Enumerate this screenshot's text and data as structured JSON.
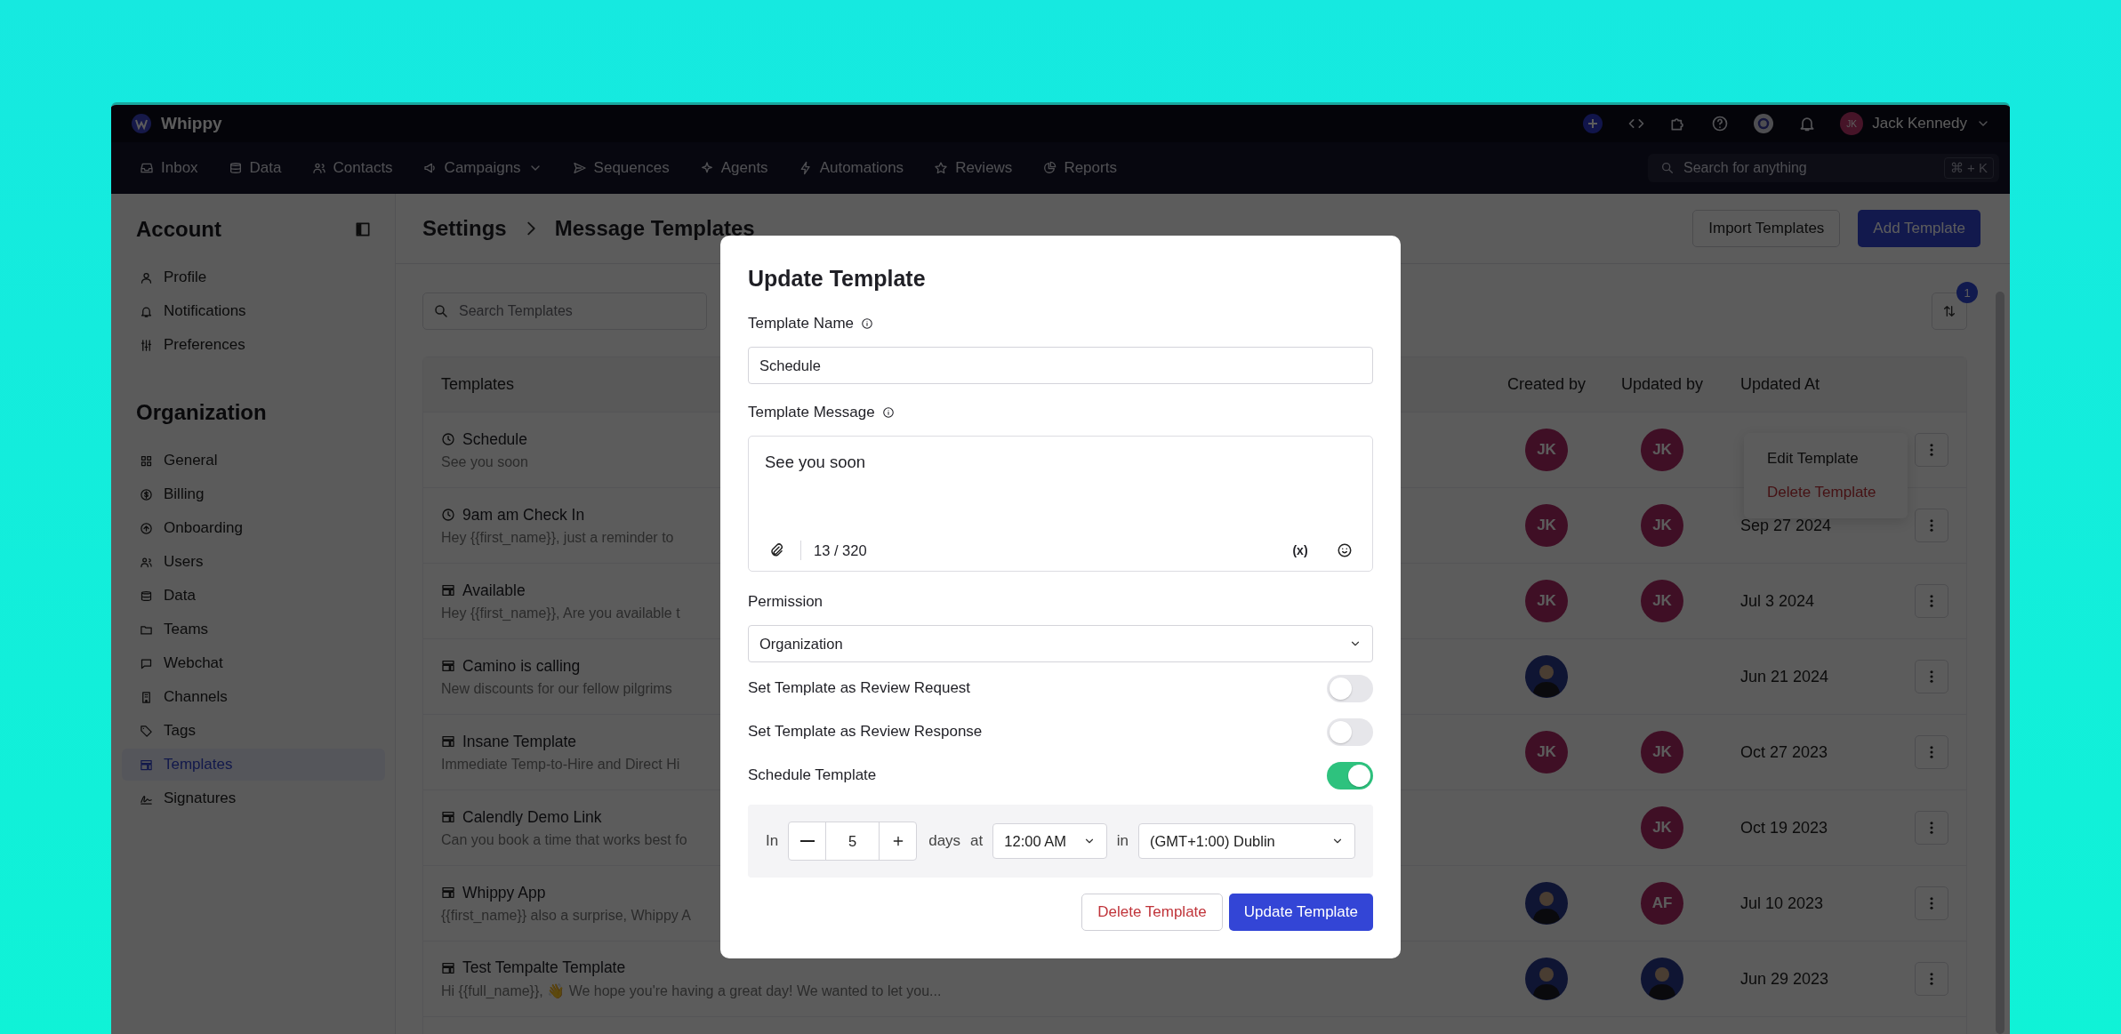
{
  "app": {
    "name": "Whippy"
  },
  "top_bar": {
    "user": {
      "initials": "JK",
      "name": "Jack Kennedy"
    }
  },
  "nav": {
    "items": [
      {
        "label": "Inbox",
        "dropdown": false
      },
      {
        "label": "Data",
        "dropdown": false
      },
      {
        "label": "Contacts",
        "dropdown": false
      },
      {
        "label": "Campaigns",
        "dropdown": true
      },
      {
        "label": "Sequences",
        "dropdown": false
      },
      {
        "label": "Agents",
        "dropdown": false
      },
      {
        "label": "Automations",
        "dropdown": false
      },
      {
        "label": "Reviews",
        "dropdown": false
      },
      {
        "label": "Reports",
        "dropdown": false
      }
    ],
    "search": {
      "placeholder": "Search for anything",
      "shortcut": "⌘ + K"
    }
  },
  "sidebar": {
    "sections": [
      {
        "title": "Account",
        "items": [
          {
            "label": "Profile",
            "selected": false
          },
          {
            "label": "Notifications",
            "selected": false
          },
          {
            "label": "Preferences",
            "selected": false
          }
        ]
      },
      {
        "title": "Organization",
        "items": [
          {
            "label": "General",
            "selected": false
          },
          {
            "label": "Billing",
            "selected": false
          },
          {
            "label": "Onboarding",
            "selected": false
          },
          {
            "label": "Users",
            "selected": false
          },
          {
            "label": "Data",
            "selected": false
          },
          {
            "label": "Teams",
            "selected": false
          },
          {
            "label": "Webchat",
            "selected": false
          },
          {
            "label": "Channels",
            "selected": false
          },
          {
            "label": "Tags",
            "selected": false
          },
          {
            "label": "Templates",
            "selected": true
          },
          {
            "label": "Signatures",
            "selected": false
          }
        ]
      }
    ]
  },
  "breadcrumb": [
    "Settings",
    "Message Templates"
  ],
  "header_buttons": [
    {
      "label": "Import Templates",
      "kind": "secondary"
    },
    {
      "label": "Add Template",
      "kind": "primary"
    }
  ],
  "search": {
    "placeholder": "Search Templates"
  },
  "sort": {
    "badge": "1"
  },
  "table": {
    "columns": [
      "Templates",
      "Created by",
      "Updated by",
      "Updated At"
    ],
    "rows": [
      {
        "kind": "scheduled",
        "name": "Schedule",
        "message": "See you soon",
        "created_by": {
          "kind": "initials",
          "initials": "JK"
        },
        "updated_by": {
          "kind": "initials",
          "initials": "JK"
        }
      },
      {
        "kind": "scheduled",
        "name": "9am am Check In",
        "message": "Hey {{first_name}}, just a reminder to",
        "created_by": {
          "kind": "initials",
          "initials": "JK"
        },
        "updated_by": {
          "kind": "initials",
          "initials": "JK"
        },
        "updated_at": "Sep 27 2024"
      },
      {
        "kind": "standard",
        "name": "Available",
        "message": "Hey {{first_name}}, Are you available t",
        "created_by": {
          "kind": "initials",
          "initials": "JK"
        },
        "updated_by": {
          "kind": "initials",
          "initials": "JK"
        },
        "updated_at": "Jul 3 2024"
      },
      {
        "kind": "standard",
        "name": "Camino is calling",
        "message": "New discounts for our fellow pilgrims",
        "created_by": {
          "kind": "photo"
        },
        "updated_at": "Jun 21 2024"
      },
      {
        "kind": "standard",
        "name": "Insane Template",
        "message": "Immediate Temp-to-Hire and Direct Hi",
        "created_by": {
          "kind": "initials",
          "initials": "JK"
        },
        "updated_by": {
          "kind": "initials",
          "initials": "JK"
        },
        "updated_at": "Oct 27 2023"
      },
      {
        "kind": "standard",
        "name": "Calendly Demo Link",
        "message": "Can you book a time that works best fo",
        "updated_by": {
          "kind": "initials",
          "initials": "JK"
        },
        "updated_at": "Oct 19 2023"
      },
      {
        "kind": "standard",
        "name": "Whippy App",
        "message": "{{first_name}} also a surprise, Whippy A",
        "created_by": {
          "kind": "photo"
        },
        "updated_by": {
          "kind": "initials",
          "initials": "AF"
        },
        "updated_at": "Jul 10 2023"
      },
      {
        "kind": "standard",
        "name": "Test Tempalte Template",
        "message": "Hi {{full_name}}, 👋 We hope you're having a great day! We wanted to let you...",
        "created_by": {
          "kind": "photo"
        },
        "updated_by": {
          "kind": "photo"
        },
        "updated_at": "Jun 29 2023"
      }
    ]
  },
  "context_menu": {
    "items": [
      {
        "label": "Edit Template",
        "kind": "normal"
      },
      {
        "label": "Delete Template",
        "kind": "danger"
      }
    ]
  },
  "modal": {
    "title": "Update Template",
    "name_field": {
      "label": "Template Name",
      "value": "Schedule"
    },
    "message_field": {
      "label": "Template Message",
      "value": "See you soon",
      "counter": "13 / 320",
      "variable_button": "(x)"
    },
    "permission": {
      "label": "Permission",
      "value": "Organization"
    },
    "toggles": [
      {
        "label": "Set Template as Review Request",
        "on": false
      },
      {
        "label": "Set Template as Review Response",
        "on": false
      },
      {
        "label": "Schedule Template",
        "on": true
      }
    ],
    "schedule": {
      "prefix": "In",
      "days": "5",
      "days_label": "days",
      "at_label": "at",
      "time": "12:00 AM",
      "in_label": "in",
      "timezone": "(GMT+1:00) Dublin"
    },
    "buttons": [
      {
        "label": "Delete Template",
        "kind": "danger"
      },
      {
        "label": "Update Template",
        "kind": "primary"
      }
    ]
  }
}
